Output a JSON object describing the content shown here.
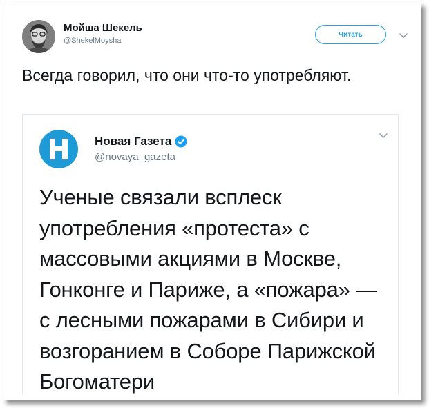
{
  "tweet": {
    "author": {
      "name": "Мойша Шекель",
      "handle": "@ShekelMoysha",
      "avatar_icon": "avatar-photo"
    },
    "follow_label": "Читать",
    "menu_icon": "chevron-down-icon",
    "text": "Всегда говорил, что они что-то употребляют."
  },
  "quoted_tweet": {
    "author": {
      "name": "Новая Газета",
      "handle": "@novaya_gazeta",
      "logo_icon": "novaya-gazeta-logo",
      "verified_icon": "verified-badge-icon"
    },
    "menu_icon": "chevron-down-icon",
    "text": "Ученые связали всплеск употребления «протеста» с массовыми акциями в Москве, Гонконге и Париже, а «пожара» — с лесными пожарами в Сибири и возгоранием в Соборе Парижской Богоматери"
  },
  "colors": {
    "accent": "#1da1f2",
    "secondary_text": "#657786",
    "logo_blue": "#1e9bd7"
  }
}
